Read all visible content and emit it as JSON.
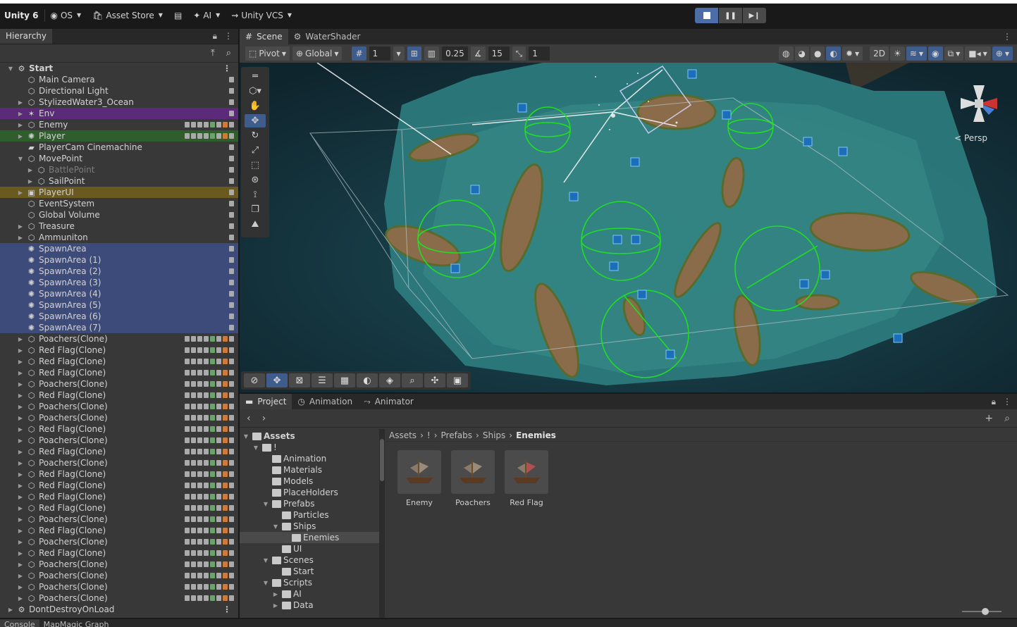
{
  "toolbar": {
    "unity_label": "Unity 6",
    "account_label": "OS",
    "asset_store_label": "Asset Store",
    "ai_label": "AI",
    "vcs_label": "Unity VCS"
  },
  "hierarchy": {
    "tab_label": "Hierarchy",
    "rows": [
      {
        "label": "Start",
        "depth": 0,
        "icon": "scene-icon",
        "expand": "open",
        "style": "root",
        "menu": true
      },
      {
        "label": "Main Camera",
        "depth": 1,
        "icon": "gameobject-icon",
        "expand": "none"
      },
      {
        "label": "Directional Light",
        "depth": 1,
        "icon": "gameobject-icon",
        "expand": "none"
      },
      {
        "label": "StylizedWater3_Ocean",
        "depth": 1,
        "icon": "gameobject-icon",
        "expand": "closed"
      },
      {
        "label": "Env",
        "depth": 1,
        "icon": "env-icon",
        "expand": "closed",
        "style": "purple"
      },
      {
        "label": "Enemy",
        "depth": 1,
        "icon": "gameobject-icon",
        "expand": "closed",
        "badges": true
      },
      {
        "label": "Player",
        "depth": 1,
        "icon": "player-icon",
        "expand": "closed",
        "style": "green",
        "badges": true
      },
      {
        "label": "PlayerCam Cinemachine",
        "depth": 1,
        "icon": "camera-icon",
        "expand": "none"
      },
      {
        "label": "MovePoint",
        "depth": 1,
        "icon": "gameobject-icon",
        "expand": "open"
      },
      {
        "label": "BattlePoint",
        "depth": 2,
        "icon": "gameobject-icon",
        "expand": "closed",
        "style": "dim"
      },
      {
        "label": "SailPoint",
        "depth": 2,
        "icon": "gameobject-icon",
        "expand": "closed"
      },
      {
        "label": "PlayerUI",
        "depth": 1,
        "icon": "ui-icon",
        "expand": "closed",
        "style": "gold"
      },
      {
        "label": "EventSystem",
        "depth": 1,
        "icon": "gameobject-icon",
        "expand": "none"
      },
      {
        "label": "Global Volume",
        "depth": 1,
        "icon": "gameobject-icon",
        "expand": "none"
      },
      {
        "label": "Treasure",
        "depth": 1,
        "icon": "gameobject-icon",
        "expand": "closed"
      },
      {
        "label": "Ammuniton",
        "depth": 1,
        "icon": "gameobject-icon",
        "expand": "closed"
      },
      {
        "label": "SpawnArea",
        "depth": 1,
        "icon": "spawn-icon",
        "expand": "none",
        "style": "selected"
      },
      {
        "label": "SpawnArea (1)",
        "depth": 1,
        "icon": "spawn-icon",
        "expand": "none",
        "style": "selected"
      },
      {
        "label": "SpawnArea (2)",
        "depth": 1,
        "icon": "spawn-icon",
        "expand": "none",
        "style": "selected"
      },
      {
        "label": "SpawnArea (3)",
        "depth": 1,
        "icon": "spawn-icon",
        "expand": "none",
        "style": "selected"
      },
      {
        "label": "SpawnArea (4)",
        "depth": 1,
        "icon": "spawn-icon",
        "expand": "none",
        "style": "selected"
      },
      {
        "label": "SpawnArea (5)",
        "depth": 1,
        "icon": "spawn-icon",
        "expand": "none",
        "style": "selected"
      },
      {
        "label": "SpawnArea (6)",
        "depth": 1,
        "icon": "spawn-icon",
        "expand": "none",
        "style": "selected"
      },
      {
        "label": "SpawnArea (7)",
        "depth": 1,
        "icon": "spawn-icon",
        "expand": "none",
        "style": "selected"
      },
      {
        "label": "Poachers(Clone)",
        "depth": 1,
        "icon": "gameobject-icon",
        "expand": "closed",
        "badges": true
      },
      {
        "label": "Red Flag(Clone)",
        "depth": 1,
        "icon": "gameobject-icon",
        "expand": "closed",
        "badges": true
      },
      {
        "label": "Red Flag(Clone)",
        "depth": 1,
        "icon": "gameobject-icon",
        "expand": "closed",
        "badges": true
      },
      {
        "label": "Red Flag(Clone)",
        "depth": 1,
        "icon": "gameobject-icon",
        "expand": "closed",
        "badges": true
      },
      {
        "label": "Poachers(Clone)",
        "depth": 1,
        "icon": "gameobject-icon",
        "expand": "closed",
        "badges": true
      },
      {
        "label": "Red Flag(Clone)",
        "depth": 1,
        "icon": "gameobject-icon",
        "expand": "closed",
        "badges": true
      },
      {
        "label": "Poachers(Clone)",
        "depth": 1,
        "icon": "gameobject-icon",
        "expand": "closed",
        "badges": true
      },
      {
        "label": "Poachers(Clone)",
        "depth": 1,
        "icon": "gameobject-icon",
        "expand": "closed",
        "badges": true
      },
      {
        "label": "Red Flag(Clone)",
        "depth": 1,
        "icon": "gameobject-icon",
        "expand": "closed",
        "badges": true
      },
      {
        "label": "Poachers(Clone)",
        "depth": 1,
        "icon": "gameobject-icon",
        "expand": "closed",
        "badges": true
      },
      {
        "label": "Red Flag(Clone)",
        "depth": 1,
        "icon": "gameobject-icon",
        "expand": "closed",
        "badges": true
      },
      {
        "label": "Poachers(Clone)",
        "depth": 1,
        "icon": "gameobject-icon",
        "expand": "closed",
        "badges": true
      },
      {
        "label": "Red Flag(Clone)",
        "depth": 1,
        "icon": "gameobject-icon",
        "expand": "closed",
        "badges": true
      },
      {
        "label": "Red Flag(Clone)",
        "depth": 1,
        "icon": "gameobject-icon",
        "expand": "closed",
        "badges": true
      },
      {
        "label": "Red Flag(Clone)",
        "depth": 1,
        "icon": "gameobject-icon",
        "expand": "closed",
        "badges": true
      },
      {
        "label": "Red Flag(Clone)",
        "depth": 1,
        "icon": "gameobject-icon",
        "expand": "closed",
        "badges": true
      },
      {
        "label": "Poachers(Clone)",
        "depth": 1,
        "icon": "gameobject-icon",
        "expand": "closed",
        "badges": true
      },
      {
        "label": "Red Flag(Clone)",
        "depth": 1,
        "icon": "gameobject-icon",
        "expand": "closed",
        "badges": true
      },
      {
        "label": "Poachers(Clone)",
        "depth": 1,
        "icon": "gameobject-icon",
        "expand": "closed",
        "badges": true
      },
      {
        "label": "Red Flag(Clone)",
        "depth": 1,
        "icon": "gameobject-icon",
        "expand": "closed",
        "badges": true
      },
      {
        "label": "Poachers(Clone)",
        "depth": 1,
        "icon": "gameobject-icon",
        "expand": "closed",
        "badges": true
      },
      {
        "label": "Poachers(Clone)",
        "depth": 1,
        "icon": "gameobject-icon",
        "expand": "closed",
        "badges": true
      },
      {
        "label": "Poachers(Clone)",
        "depth": 1,
        "icon": "gameobject-icon",
        "expand": "closed",
        "badges": true
      },
      {
        "label": "Poachers(Clone)",
        "depth": 1,
        "icon": "gameobject-icon",
        "expand": "closed",
        "badges": true
      },
      {
        "label": "DontDestroyOnLoad",
        "depth": 0,
        "icon": "scene-icon",
        "expand": "closed",
        "menu": true
      }
    ]
  },
  "scene": {
    "tabs": [
      {
        "label": "Scene",
        "icon": "grid-icon",
        "active": true
      },
      {
        "label": "WaterShader",
        "icon": "shader-icon",
        "active": false
      }
    ],
    "pivot_label": "Pivot",
    "global_label": "Global",
    "grid_size": "1",
    "snap_value": "0.25",
    "angle_value": "15",
    "scale_value": "1",
    "persp_label": "Persp"
  },
  "project": {
    "tabs": [
      {
        "label": "Project",
        "icon": "folder-icon",
        "active": true
      },
      {
        "label": "Animation",
        "icon": "clock-icon",
        "active": false
      },
      {
        "label": "Animator",
        "icon": "animator-icon",
        "active": false
      }
    ],
    "tree": [
      {
        "label": "Assets",
        "depth": 0,
        "expand": "open",
        "bold": true
      },
      {
        "label": "!",
        "depth": 1,
        "expand": "open"
      },
      {
        "label": "Animation",
        "depth": 2,
        "expand": "none"
      },
      {
        "label": "Materials",
        "depth": 2,
        "expand": "none"
      },
      {
        "label": "Models",
        "depth": 2,
        "expand": "none"
      },
      {
        "label": "PlaceHolders",
        "depth": 2,
        "expand": "none"
      },
      {
        "label": "Prefabs",
        "depth": 2,
        "expand": "open"
      },
      {
        "label": "Particles",
        "depth": 3,
        "expand": "none"
      },
      {
        "label": "Ships",
        "depth": 3,
        "expand": "open"
      },
      {
        "label": "Enemies",
        "depth": 4,
        "expand": "none",
        "selected": true
      },
      {
        "label": "UI",
        "depth": 3,
        "expand": "none"
      },
      {
        "label": "Scenes",
        "depth": 2,
        "expand": "open"
      },
      {
        "label": "Start",
        "depth": 3,
        "expand": "none"
      },
      {
        "label": "Scripts",
        "depth": 2,
        "expand": "open"
      },
      {
        "label": "AI",
        "depth": 3,
        "expand": "closed"
      },
      {
        "label": "Data",
        "depth": 3,
        "expand": "closed"
      }
    ],
    "breadcrumb": [
      "Assets",
      "!",
      "Prefabs",
      "Ships",
      "Enemies"
    ],
    "assets": [
      {
        "label": "Enemy"
      },
      {
        "label": "Poachers"
      },
      {
        "label": "Red Flag"
      }
    ]
  },
  "status": {
    "tabs": [
      {
        "label": "Console",
        "active": true
      },
      {
        "label": "MapMagic Graph",
        "active": false
      }
    ]
  },
  "colors": {
    "selection": "#3d4b7a",
    "accent": "#3e5c8c",
    "gizmo_green": "#22dd22",
    "water": "#1f5a62"
  }
}
